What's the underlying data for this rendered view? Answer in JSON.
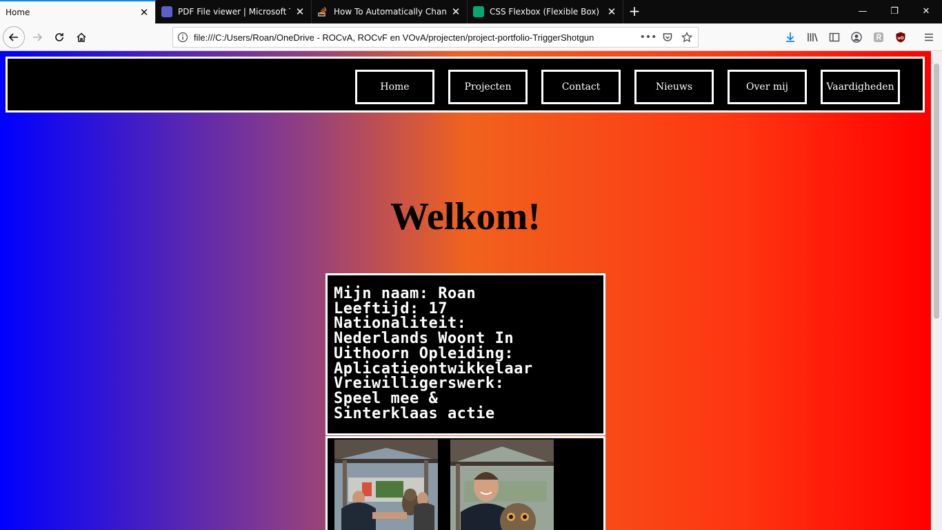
{
  "browser": {
    "tabs": [
      {
        "title": "Home",
        "active": true
      },
      {
        "title": "PDF File viewer | Microsoft Teams",
        "active": false
      },
      {
        "title": "How To Automatically Change",
        "active": false
      },
      {
        "title": "CSS Flexbox (Flexible Box)",
        "active": false
      }
    ],
    "url": "file:///C:/Users/Roan/OneDrive - ROCvA, ROCvF en VOvA/projecten/project-portfolio-TriggerShotgun",
    "colors": {
      "accent": "#0a84ff",
      "teams": "#5b5fc7",
      "stackoverflow": "#f48024",
      "w3schools": "#04aa6d"
    }
  },
  "page": {
    "nav": [
      "Home",
      "Projecten",
      "Contact",
      "Nieuws",
      "Over mij",
      "Vaardigheden"
    ],
    "heading": "Welkom!",
    "info_lines": [
      "Mijn naam: Roan",
      "Leeftijd: 17",
      "Nationaliteit:",
      "Nederlands Woont In",
      "Uithoorn Opleiding:",
      "Aplicatieontwikkelaar",
      "Vreiwilligerswerk:",
      "Speel mee &",
      "Sinterklaas actie"
    ],
    "photos": [
      "photo-person-with-owl-1",
      "photo-person-with-owl-2"
    ],
    "gradient_colors": [
      "#0000ff",
      "#f0621e",
      "#ff0000"
    ]
  }
}
